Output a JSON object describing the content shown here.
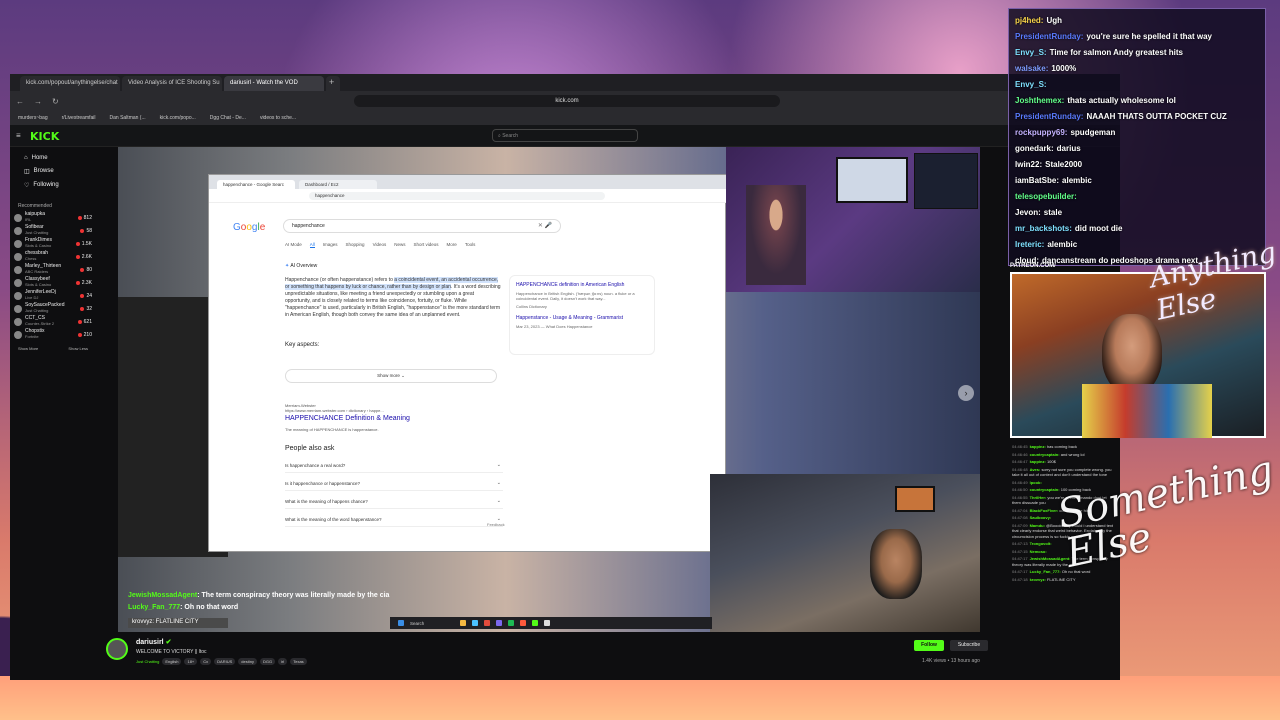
{
  "browser": {
    "tabs": [
      "kick.com/popout/anythingelse/chat",
      "Video Analysis of ICE Shooting Su",
      "dariusirl - Watch the VOD"
    ],
    "new_tab": "+",
    "url": "kick.com",
    "bookmarks": [
      "murders~bag",
      "r/Livestreamfail",
      "Dan Saltman (...",
      "kick.com/popo...",
      "Dgg Chat - De...",
      "videos to sche..."
    ]
  },
  "kick": {
    "logo": "KICK",
    "search_placeholder": "Search",
    "nav": [
      "Home",
      "Browse",
      "Following"
    ],
    "recommended_label": "Recommended",
    "channels": [
      {
        "name": "kaipupka",
        "game": "IRL",
        "viewers": "812"
      },
      {
        "name": "Sofibear",
        "game": "Just Chatting",
        "viewers": "58"
      },
      {
        "name": "FrankDimes",
        "game": "Slots & Casino",
        "viewers": "1.5K"
      },
      {
        "name": "chessbrah",
        "game": "Chess",
        "viewers": "2.6K"
      },
      {
        "name": "Marley_Thirteen",
        "game": "ABC Raiders",
        "viewers": "80"
      },
      {
        "name": "Classybeef",
        "game": "Slots & Casino",
        "viewers": "2.3K"
      },
      {
        "name": "JenniferLeeDj",
        "game": "Live DJ",
        "viewers": "24"
      },
      {
        "name": "SoySaucePacked",
        "game": "Just Chatting",
        "viewers": "32"
      },
      {
        "name": "CCT_CS",
        "game": "Counter-Strike 2",
        "viewers": "621"
      },
      {
        "name": "Chopstix",
        "game": "Fortnite",
        "viewers": "210"
      }
    ],
    "show_more": "Show More",
    "show_less": "Show Less"
  },
  "google": {
    "tabs": [
      "happenchance - Google Searc",
      "Dashboard / Ec2"
    ],
    "url": "happenchance",
    "logo": "Google",
    "query": "happenchance",
    "filters": [
      "AI Mode",
      "All",
      "Images",
      "Shopping",
      "Videos",
      "News",
      "Short videos",
      "More",
      "Tools"
    ],
    "ai_overview": "AI Overview",
    "ai_text_1": "Happenchance (or often happenstance) refers to ",
    "ai_text_hl": "a coincidental event, an accidental occurrence, or something that happens by luck or chance, rather than by design or plan",
    "ai_text_2": ". It's a word describing unpredictable situations, like meeting a friend unexpectedly or stumbling upon a great opportunity, and is closely related to terms like coincidence, fortuity, or fluke. While \"happenchance\" is used, particularly in British English, \"happenstance\" is the more standard term in American English, though both convey the same idea of an unplanned event.",
    "card_title": "HAPPENCHANCE definition in American English",
    "card_text": "Happenchance in British English. ('hæpənˌtʃɑːns) noun. a fluke or a coincidental event. Daily, it doesn't work that way...",
    "card_source": "Collins Dictionary",
    "card2_title": "Happenstance - Usage & Meaning - Grammarist",
    "card2_date": "Mar 23, 2023 — What Does Happenstance",
    "key_aspects": "Key aspects:",
    "show_more": "Show more",
    "mw_name": "Merriam-Webster",
    "mw_url": "https://www.merriam-webster.com › dictionary › happe...",
    "mw_link": "HAPPENCHANCE Definition & Meaning",
    "mw_snip": "The meaning of HAPPENCHANCE is happenstance.",
    "paa": "People also ask",
    "questions": [
      "Is happenchance a real word?",
      "Is it happenchance or happenstance?",
      "What is the meaning of happens chance?",
      "What is the meaning of the word happenstance?"
    ],
    "feedback": "Feedback"
  },
  "overlay_chat": [
    {
      "user": "JewishMossadAgent",
      "msg": ": The term conspiracy theory was literally made by the cia"
    },
    {
      "user": "Lucky_Fan_777",
      "msg": ": Oh no that word"
    }
  ],
  "flatline": "krovvyz: FLATLINE CITY",
  "taskbar_search": "Search",
  "stream": {
    "name": "dariusirl",
    "title": "WELCOME TO VICTORY || ltoc",
    "category": "Just Chatting",
    "tags": [
      "English",
      "18+",
      "Cx",
      "DARIUS",
      "destiny",
      "DGG",
      "irl",
      "Texas"
    ],
    "follow": "Follow",
    "subscribe": "Subscribe",
    "views": "1.4K views • 13 hours ago"
  },
  "chat_overlay": [
    {
      "user": "pj4hed:",
      "msg": "Ugh",
      "color": "#f7d34a"
    },
    {
      "user": "PresidentRunday:",
      "msg": "you're sure he spelled it that way",
      "color": "#5a7bff"
    },
    {
      "user": "Envy_S:",
      "msg": "Time for salmon Andy greatest hits",
      "color": "#7fe0ff"
    },
    {
      "user": "walsake:",
      "msg": "1000%",
      "color": "#7f9cff"
    },
    {
      "user": "Envy_S:",
      "msg": "",
      "color": "#7fe0ff"
    },
    {
      "user": "Joshthemex:",
      "msg": "thats actually wholesome lol",
      "color": "#62ff8a"
    },
    {
      "user": "PresidentRunday:",
      "msg": "NAAAH THATS OUTTA POCKET CUZ",
      "color": "#5a7bff"
    },
    {
      "user": "rockpuppy69:",
      "msg": "spudgeman",
      "color": "#c4b2ff"
    },
    {
      "user": "gonedark:",
      "msg": "darius",
      "color": "#ffffff"
    },
    {
      "user": "lwin22:",
      "msg": "Stale2000",
      "color": "#ffffff"
    },
    {
      "user": "iamBatSbe:",
      "msg": "alembic",
      "color": "#ffffff"
    },
    {
      "user": "telesopebuilder:",
      "msg": "",
      "color": "#62ff8a"
    },
    {
      "user": "Jevon:",
      "msg": "stale",
      "color": "#ffffff"
    },
    {
      "user": "mr_backshots:",
      "msg": "did moot die",
      "color": "#7fe0ff"
    },
    {
      "user": "Ireteric:",
      "msg": "alembic",
      "color": "#7fe0ff"
    },
    {
      "user": "cloud:",
      "msg": "dancanstream do pedoshops drama next",
      "color": "#ffffff"
    }
  ],
  "patreon": "PATREON.COM/",
  "brand_small": "Anything Else",
  "brand_big": "Something Else",
  "right_chat": [
    {
      "t": "04:46:45",
      "n": "kappinz:",
      "m": "has coming back"
    },
    {
      "t": "04:46:46",
      "n": "countrycaptain:",
      "m": "and wrong lol"
    },
    {
      "t": "04:46:47",
      "n": "kappinz:",
      "m": "100$"
    },
    {
      "t": "04:46:48",
      "n": "Aves:",
      "m": "sorry not sure you complete wrong. you take it all out of context and don't understand the tone"
    },
    {
      "t": "04:46:49",
      "n": "Ipoob:",
      "m": ""
    },
    {
      "t": "04:46:50",
      "n": "countrycaptain:",
      "m": "100 coming back"
    },
    {
      "t": "04:46:55",
      "n": "ThrilHer:",
      "m": "you we're spelling mando dont let them dissuade you"
    },
    {
      "t": "04:47:04",
      "n": "BlackFoxFlver:",
      "m": "come debate him"
    },
    {
      "t": "04:47:08",
      "n": "Saulboovy:",
      "m": ""
    },
    {
      "t": "04:47:09",
      "n": "Mamdu:",
      "m": "@Boooid why would i understand text that clearly endorse that weird behavior. Explain why the circumcision process is so fuckin weird?"
    },
    {
      "t": "04:47:13",
      "n": "Trongovolt:",
      "m": ""
    },
    {
      "t": "04:47:15",
      "n": "Nemoso:",
      "m": ""
    },
    {
      "t": "04:47:17",
      "n": "JewishMossadAgent:",
      "m": "The term conspiracy theory was literally made by the cia"
    },
    {
      "t": "04:47:17",
      "n": "Lucky_Fan_777:",
      "m": "Oh no that word"
    },
    {
      "t": "04:47:18",
      "n": "krovvyz:",
      "m": "FLATLINE CITY"
    }
  ]
}
